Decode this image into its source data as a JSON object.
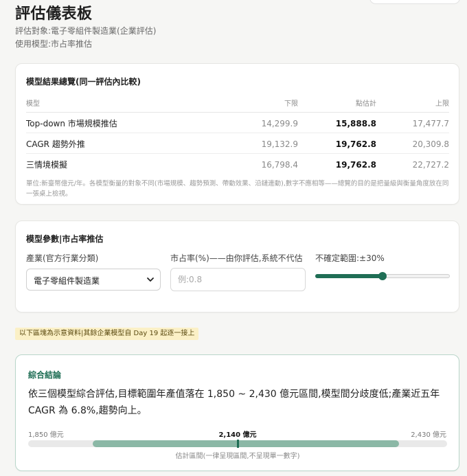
{
  "header": {
    "title": "評估儀表板",
    "target_line": "評估對象:電子零組件製造業(企業評估)",
    "model_line": "使用模型:市占率推估"
  },
  "summary": {
    "title": "模型結果總覽(同一評估內比較)",
    "columns": [
      "模型",
      "下限",
      "點估計",
      "上限"
    ],
    "rows": [
      {
        "model": "Top-down 市場規模推估",
        "low": "14,299.9",
        "point": "15,888.8",
        "high": "17,477.7"
      },
      {
        "model": "CAGR 趨勢外推",
        "low": "19,132.9",
        "point": "19,762.8",
        "high": "20,309.8"
      },
      {
        "model": "三情境模擬",
        "low": "16,798.4",
        "point": "19,762.8",
        "high": "22,727.2"
      }
    ],
    "note": "單位:新臺幣億元/年。各模型衡量的對象不同(市場規模、趨勢預測、帶動效果、沿鏈連動),數字不應相等——總覽的目的是把量級與衡量角度放在同一張桌上檢視。"
  },
  "params": {
    "title": "模型參數|市占率推估",
    "industry": {
      "label": "產業(官方行業分類)",
      "value": "電子零組件製造業"
    },
    "share": {
      "label": "市占率(%)——由你評估,系統不代估",
      "placeholder": "例:0.8",
      "value": ""
    },
    "uncertainty": {
      "label": "不確定範圍:±30%",
      "level_percent": 30,
      "max_percent": 60,
      "accent": "#1f6e55"
    }
  },
  "demo_notice": "以下區塊為示意資料|其餘企業模型自 Day 19 起逐一接上",
  "conclusion": {
    "title": "綜合結論",
    "body": "依三個模型綜合評估,目標範圍年產值落在 1,850 ~ 2,430 億元區間,模型間分歧度低;產業近五年 CAGR 為 6.8%,趨勢向上。",
    "range": {
      "low_label": "1,850 億元",
      "mid_label": "2,140 億元",
      "high_label": "2,430 億元",
      "axis_min": 1850,
      "axis_max": 2430,
      "band_low": 1939,
      "band_high": 2363,
      "point": 2140
    },
    "caption": "估計區間(一律呈現區間,不呈現單一數字)",
    "accent": "#1f6e55",
    "band_color": "#8bb8a6"
  }
}
